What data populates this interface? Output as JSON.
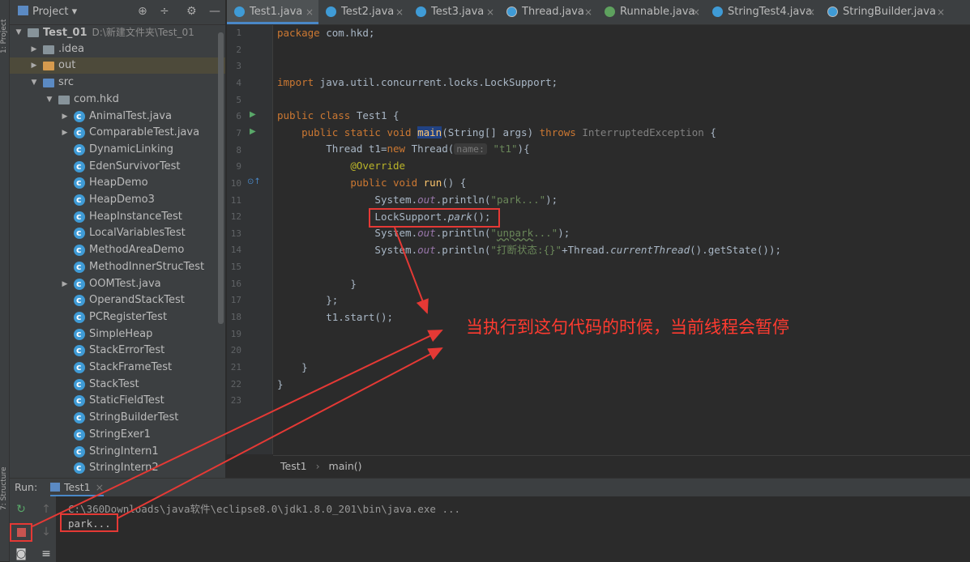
{
  "left_strip": {
    "project_tab": "1: Project",
    "structure_tab": "7: Structure"
  },
  "project_panel": {
    "title": "Project",
    "icons": [
      "target-icon",
      "collapse-icon",
      "gear-icon",
      "minimize-icon"
    ],
    "tree": [
      {
        "label": "Test_01",
        "path": "D:\\新建文件夹\\Test_01",
        "icon": "folder",
        "indent": 0,
        "arrow": "▼"
      },
      {
        "label": ".idea",
        "icon": "folder",
        "indent": 1,
        "arrow": "▶"
      },
      {
        "label": "out",
        "icon": "folder-out",
        "indent": 1,
        "arrow": "▶"
      },
      {
        "label": "src",
        "icon": "folder-src",
        "indent": 1,
        "arrow": "▼"
      },
      {
        "label": "com.hkd",
        "icon": "pkg",
        "indent": 2,
        "arrow": "▼"
      },
      {
        "label": "AnimalTest.java",
        "icon": "cls",
        "indent": 3,
        "arrow": "▶"
      },
      {
        "label": "ComparableTest.java",
        "icon": "cls",
        "indent": 3,
        "arrow": "▶"
      },
      {
        "label": "DynamicLinking",
        "icon": "cls",
        "indent": 3,
        "arrow": ""
      },
      {
        "label": "EdenSurvivorTest",
        "icon": "cls",
        "indent": 3,
        "arrow": ""
      },
      {
        "label": "HeapDemo",
        "icon": "cls",
        "indent": 3,
        "arrow": ""
      },
      {
        "label": "HeapDemo3",
        "icon": "cls",
        "indent": 3,
        "arrow": ""
      },
      {
        "label": "HeapInstanceTest",
        "icon": "cls",
        "indent": 3,
        "arrow": ""
      },
      {
        "label": "LocalVariablesTest",
        "icon": "cls",
        "indent": 3,
        "arrow": ""
      },
      {
        "label": "MethodAreaDemo",
        "icon": "cls",
        "indent": 3,
        "arrow": ""
      },
      {
        "label": "MethodInnerStrucTest",
        "icon": "cls",
        "indent": 3,
        "arrow": ""
      },
      {
        "label": "OOMTest.java",
        "icon": "cls",
        "indent": 3,
        "arrow": "▶"
      },
      {
        "label": "OperandStackTest",
        "icon": "cls",
        "indent": 3,
        "arrow": ""
      },
      {
        "label": "PCRegisterTest",
        "icon": "cls",
        "indent": 3,
        "arrow": ""
      },
      {
        "label": "SimpleHeap",
        "icon": "cls",
        "indent": 3,
        "arrow": ""
      },
      {
        "label": "StackErrorTest",
        "icon": "cls",
        "indent": 3,
        "arrow": ""
      },
      {
        "label": "StackFrameTest",
        "icon": "cls",
        "indent": 3,
        "arrow": ""
      },
      {
        "label": "StackTest",
        "icon": "cls",
        "indent": 3,
        "arrow": ""
      },
      {
        "label": "StaticFieldTest",
        "icon": "cls",
        "indent": 3,
        "arrow": ""
      },
      {
        "label": "StringBuilderTest",
        "icon": "cls",
        "indent": 3,
        "arrow": ""
      },
      {
        "label": "StringExer1",
        "icon": "cls",
        "indent": 3,
        "arrow": ""
      },
      {
        "label": "StringIntern1",
        "icon": "cls",
        "indent": 3,
        "arrow": ""
      },
      {
        "label": "StringIntern2",
        "icon": "cls",
        "indent": 3,
        "arrow": ""
      }
    ]
  },
  "tabs": [
    {
      "label": "Test1.java",
      "icon": "class",
      "active": true
    },
    {
      "label": "Test2.java",
      "icon": "class"
    },
    {
      "label": "Test3.java",
      "icon": "class"
    },
    {
      "label": "Thread.java",
      "icon": "lib"
    },
    {
      "label": "Runnable.java",
      "icon": "iface"
    },
    {
      "label": "StringTest4.java",
      "icon": "class"
    },
    {
      "label": "StringBuilder.java",
      "icon": "lib"
    }
  ],
  "editor": {
    "line_numbers": [
      "1",
      "2",
      "3",
      "4",
      "5",
      "6",
      "7",
      "8",
      "9",
      "10",
      "11",
      "12",
      "13",
      "14",
      "15",
      "16",
      "17",
      "18",
      "19",
      "20",
      "21",
      "22",
      "23"
    ],
    "code": {
      "l1_kw": "package",
      "l1_rest": " com.hkd;",
      "l4_kw": "import",
      "l4_rest": " java.util.concurrent.locks.LockSupport;",
      "l6_kw": "public class",
      "l6_rest": " Test1 {",
      "l7_kw": "public static void",
      "l7_main": "main",
      "l7_args": "(String[] args) ",
      "l7_throws": "throws",
      "l7_exc": " InterruptedException",
      "l7_end": " {",
      "l8_a": "Thread t1=",
      "l8_new": "new",
      "l8_b": " Thread(",
      "l8_hint": "name:",
      "l8_str": "\"t1\"",
      "l8_c": "){",
      "l9_ann": "@Override",
      "l10_kw": "public void",
      "l10_fn": "run",
      "l10_rest": "() {",
      "l11_a": "System.",
      "l11_out": "out",
      "l11_b": ".println(",
      "l11_str": "\"park...\"",
      "l11_c": ");",
      "l12_a": "LockSupport.",
      "l12_park": "park",
      "l12_b": "();",
      "l13_a": "System.",
      "l13_out": "out",
      "l13_b": ".println(",
      "l13_q1": "\"",
      "l13_str": "unpark",
      "l13_q2": "...\"",
      "l13_c": ");",
      "l14_a": "System.",
      "l14_out": "out",
      "l14_b": ".println(",
      "l14_str": "\"打断状态:{}\"",
      "l14_c": "+Thread.",
      "l14_ct": "currentThread",
      "l14_d": "().getState());",
      "l16": "}",
      "l17": "};",
      "l18": "t1.start();",
      "l21": "}",
      "l22": "}"
    }
  },
  "breadcrumb": {
    "item1": "Test1",
    "sep": "›",
    "item2": "main()"
  },
  "annotation": "当执行到这句代码的时候，当前线程会暂停",
  "run_panel": {
    "label": "Run:",
    "tab": "Test1",
    "console": [
      "C:\\360Downloads\\java软件\\eclipse8.0\\jdk1.8.0_201\\bin\\java.exe ...",
      "park..."
    ]
  },
  "colors": {
    "highlight_red": "#e53935",
    "annotation_red": "#ff3b30",
    "accent_blue": "#4a88c7"
  }
}
